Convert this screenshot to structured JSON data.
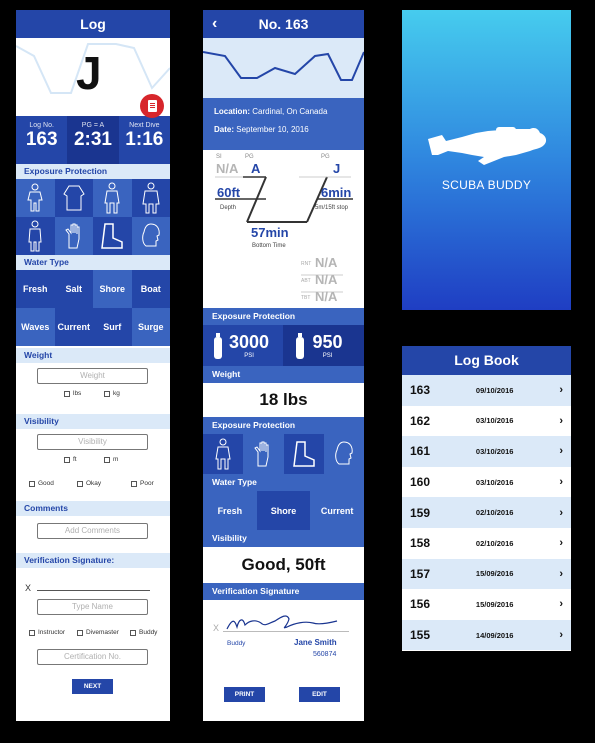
{
  "log_form": {
    "title": "Log",
    "header_initial": "J",
    "stats": [
      {
        "label": "Log No.",
        "value": "163"
      },
      {
        "label": "PG = A",
        "value": "2:31"
      },
      {
        "label": "Next Dive",
        "value": "1:16"
      }
    ],
    "exposure_label": "Exposure Protection",
    "exposure_icons": [
      "wetsuit-shorty-icon",
      "wetsuit-jacket-icon",
      "full-wetsuit-icon",
      "drysuit-icon",
      "semi-dry-suit-icon",
      "glove-icon",
      "boot-icon",
      "hood-icon"
    ],
    "water_type_label": "Water Type",
    "water_types": [
      "Fresh",
      "Salt",
      "Shore",
      "Boat",
      "Waves",
      "Current",
      "Surf",
      "Surge"
    ],
    "weight_label": "Weight",
    "weight_placeholder": "Weight",
    "weight_units": [
      "lbs",
      "kg"
    ],
    "visibility_label": "Visibility",
    "visibility_placeholder": "Visibility",
    "visibility_units": [
      "ft",
      "m"
    ],
    "visibility_ratings": [
      "Good",
      "Okay",
      "Poor"
    ],
    "comments_label": "Comments",
    "comments_placeholder": "Add Comments",
    "verification_label": "Verification Signature:",
    "x_mark": "X",
    "name_placeholder": "Type Name",
    "roles": [
      "Instructor",
      "Divemaster",
      "Buddy"
    ],
    "cert_placeholder": "Certification No.",
    "next_button": "NEXT"
  },
  "dive_detail": {
    "title": "No. 163",
    "back_glyph": "‹",
    "location_label": "Location:",
    "location": "Cardinal, On Canada",
    "date_label": "Date:",
    "date": "September 10, 2016",
    "si_label": "SI",
    "si_value": "N/A",
    "pg_label": "PG",
    "pg_start": "A",
    "pg_end": "J",
    "depth_value": "60ft",
    "depth_label": "Depth",
    "stop_value": "6min",
    "stop_label": "5m/15ft stop",
    "bottom_value": "57min",
    "bottom_label": "Bottom Time",
    "rnt_label": "RNT",
    "rnt_value": "N/A",
    "abt_label": "ABT",
    "abt_value": "N/A",
    "tbt_label": "TBT",
    "tbt_value": "N/A",
    "exposure_label": "Exposure Protection",
    "tank_start": "3000",
    "tank_start_unit": "PSI",
    "tank_end": "950",
    "tank_end_unit": "PSI",
    "weight_label": "Weight",
    "weight_value": "18 lbs",
    "exposure_label_2": "Exposure Protection",
    "exposure_icons": [
      "full-wetsuit-icon",
      "glove-icon",
      "boot-icon",
      "hood-icon"
    ],
    "water_type_label": "Water Type",
    "water_types": [
      "Fresh",
      "Shore",
      "Current"
    ],
    "visibility_label": "Visibility",
    "visibility_value": "Good, 50ft",
    "verification_label": "Verification Signature",
    "x_mark": "X",
    "role": "Buddy",
    "signer_name": "Jane Smith",
    "signer_number": "560874",
    "print_button": "PRINT",
    "edit_button": "EDIT"
  },
  "splash": {
    "app_name": "SCUBA BUDDY"
  },
  "logbook": {
    "title": "Log Book",
    "entries": [
      {
        "no": "163",
        "date": "09/10/2016"
      },
      {
        "no": "162",
        "date": "03/10/2016"
      },
      {
        "no": "161",
        "date": "03/10/2016"
      },
      {
        "no": "160",
        "date": "03/10/2016"
      },
      {
        "no": "159",
        "date": "02/10/2016"
      },
      {
        "no": "158",
        "date": "02/10/2016"
      },
      {
        "no": "157",
        "date": "15/09/2016"
      },
      {
        "no": "156",
        "date": "15/09/2016"
      },
      {
        "no": "155",
        "date": "14/09/2016"
      }
    ],
    "chevron": "›"
  },
  "colors": {
    "primary": "#2446a8",
    "light": "#dbe9f8",
    "mid": "#3a64bf"
  }
}
